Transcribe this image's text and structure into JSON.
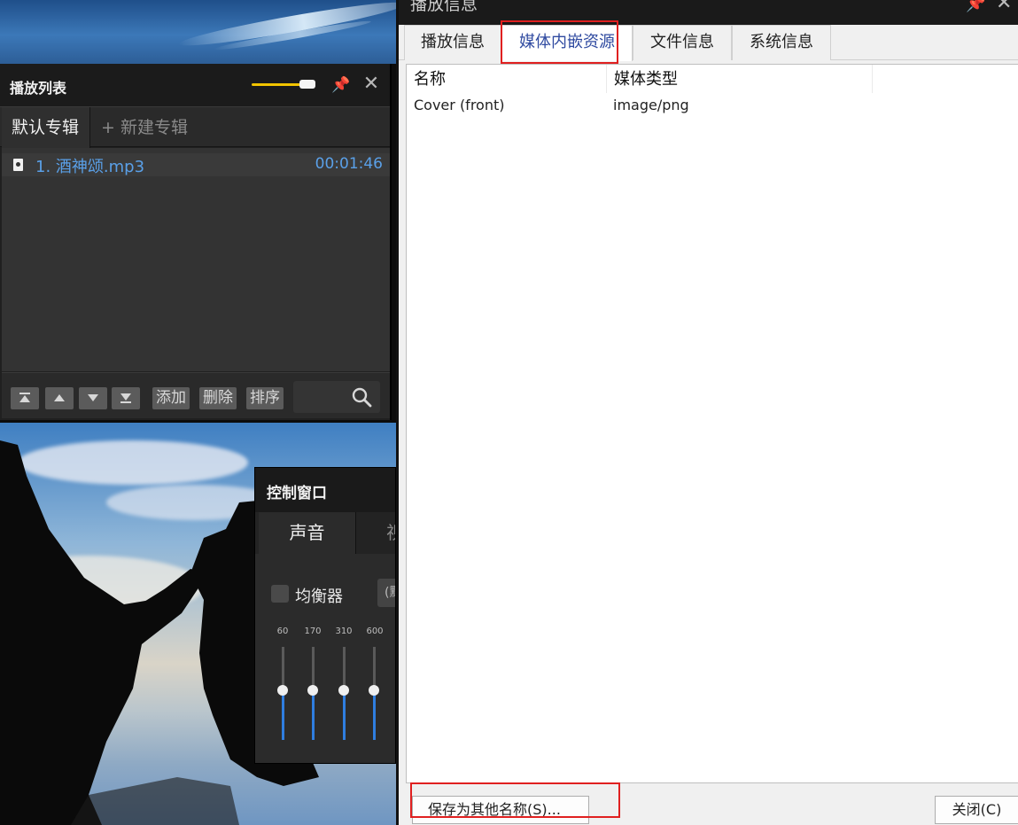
{
  "playlist": {
    "title": "播放列表",
    "volume_level": 0.82,
    "tabs": {
      "active": "默认专辑",
      "new_album": "+ 新建专辑"
    },
    "items": [
      {
        "name": "1. 酒神颂.mp3",
        "duration": "00:01:46"
      }
    ],
    "toolbar": {
      "add": "添加",
      "delete": "删除",
      "sort": "排序",
      "icons": [
        "move-top-icon",
        "move-up-icon",
        "move-down-icon",
        "move-bottom-icon",
        "search-icon"
      ]
    }
  },
  "control_window": {
    "title": "控制窗口",
    "tabs": [
      "声音",
      "视"
    ],
    "equalizer_label": "均衡器",
    "preset_value": "(默",
    "bands": [
      "60",
      "170",
      "310",
      "600"
    ]
  },
  "dialog": {
    "title": "播放信息",
    "tabs": [
      "播放信息",
      "媒体内嵌资源",
      "文件信息",
      "系统信息"
    ],
    "active_tab": "媒体内嵌资源",
    "columns": [
      "名称",
      "媒体类型"
    ],
    "rows": [
      {
        "name": "Cover (front)",
        "type": "image/png"
      }
    ],
    "buttons": {
      "save_as": "保存为其他名称(S)...",
      "close": "关闭(C)"
    }
  },
  "colors": {
    "accent_blue": "#5aa0e8",
    "volume_yellow": "#f2c400",
    "highlight_red": "#e02020",
    "active_tab_text": "#2f4aa0"
  }
}
